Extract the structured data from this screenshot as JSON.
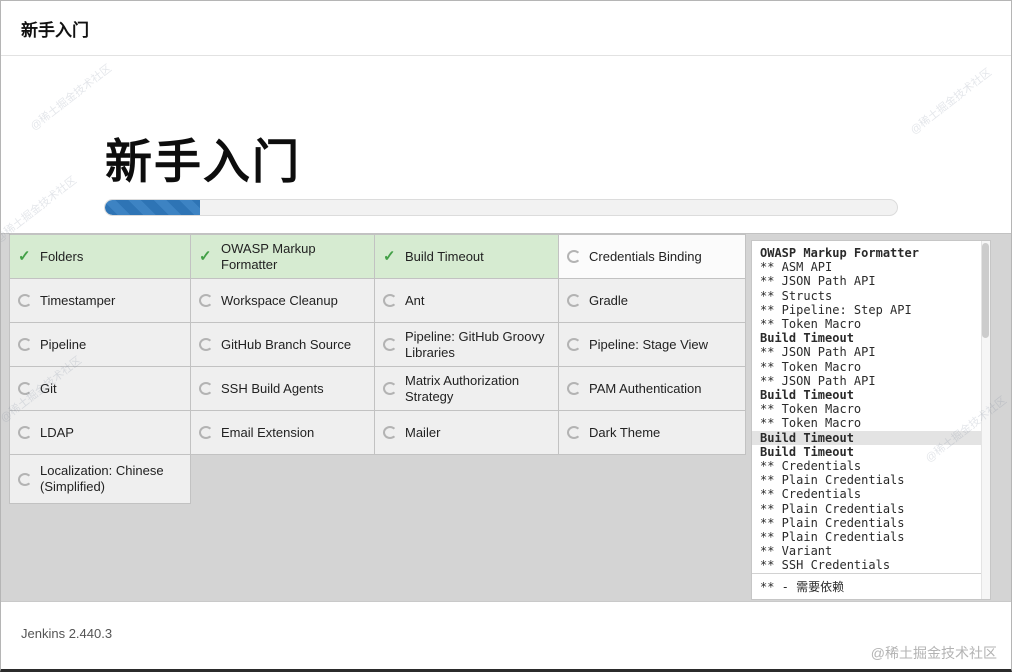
{
  "header": {
    "title": "新手入门"
  },
  "hero": {
    "title": "新手入门",
    "progress_percent": 12
  },
  "colors": {
    "accent_blue": "#2e74b5",
    "success_bg": "#d6ebd1",
    "check_green": "#43a047",
    "grid_bg": "#d4d4d4"
  },
  "plugins": {
    "columns": [
      [
        {
          "label": "Folders",
          "status": "done"
        },
        {
          "label": "Timestamper",
          "status": "pending"
        },
        {
          "label": "Pipeline",
          "status": "pending"
        },
        {
          "label": "Git",
          "status": "pending"
        },
        {
          "label": "LDAP",
          "status": "pending"
        },
        {
          "label": "Localization: Chinese (Simplified)",
          "status": "pending"
        }
      ],
      [
        {
          "label": "OWASP Markup Formatter",
          "status": "done"
        },
        {
          "label": "Workspace Cleanup",
          "status": "pending"
        },
        {
          "label": "GitHub Branch Source",
          "status": "pending"
        },
        {
          "label": "SSH Build Agents",
          "status": "pending"
        },
        {
          "label": "Email Extension",
          "status": "pending"
        }
      ],
      [
        {
          "label": "Build Timeout",
          "status": "done"
        },
        {
          "label": "Ant",
          "status": "pending"
        },
        {
          "label": "Pipeline: GitHub Groovy Libraries",
          "status": "pending"
        },
        {
          "label": "Matrix Authorization Strategy",
          "status": "pending"
        },
        {
          "label": "Mailer",
          "status": "pending"
        }
      ],
      [
        {
          "label": "Credentials Binding",
          "status": "active"
        },
        {
          "label": "Gradle",
          "status": "pending"
        },
        {
          "label": "Pipeline: Stage View",
          "status": "pending"
        },
        {
          "label": "PAM Authentication",
          "status": "pending"
        },
        {
          "label": "Dark Theme",
          "status": "pending"
        }
      ]
    ]
  },
  "log": {
    "lines": [
      {
        "text": "OWASP Markup Formatter",
        "kind": "title"
      },
      {
        "text": "** ASM API",
        "kind": "dep"
      },
      {
        "text": "** JSON Path API",
        "kind": "dep"
      },
      {
        "text": "** Structs",
        "kind": "dep"
      },
      {
        "text": "** Pipeline: Step API",
        "kind": "dep"
      },
      {
        "text": "** Token Macro",
        "kind": "dep"
      },
      {
        "text": "Build Timeout",
        "kind": "title"
      },
      {
        "text": "** JSON Path API",
        "kind": "dep"
      },
      {
        "text": "** Token Macro",
        "kind": "dep"
      },
      {
        "text": "** JSON Path API",
        "kind": "dep"
      },
      {
        "text": "Build Timeout",
        "kind": "title"
      },
      {
        "text": "** Token Macro",
        "kind": "dep"
      },
      {
        "text": "** Token Macro",
        "kind": "dep"
      },
      {
        "text": "Build Timeout",
        "kind": "title highlight"
      },
      {
        "text": "Build Timeout",
        "kind": "title"
      },
      {
        "text": "** Credentials",
        "kind": "dep"
      },
      {
        "text": "** Plain Credentials",
        "kind": "dep"
      },
      {
        "text": "** Credentials",
        "kind": "dep"
      },
      {
        "text": "** Plain Credentials",
        "kind": "dep"
      },
      {
        "text": "** Plain Credentials",
        "kind": "dep"
      },
      {
        "text": "** Plain Credentials",
        "kind": "dep"
      },
      {
        "text": "** Variant",
        "kind": "dep"
      },
      {
        "text": "** SSH Credentials",
        "kind": "dep"
      }
    ],
    "footer": "** - 需要依赖"
  },
  "footer": {
    "version": "Jenkins 2.440.3"
  },
  "watermark": {
    "text": "@稀土掘金技术社区"
  }
}
